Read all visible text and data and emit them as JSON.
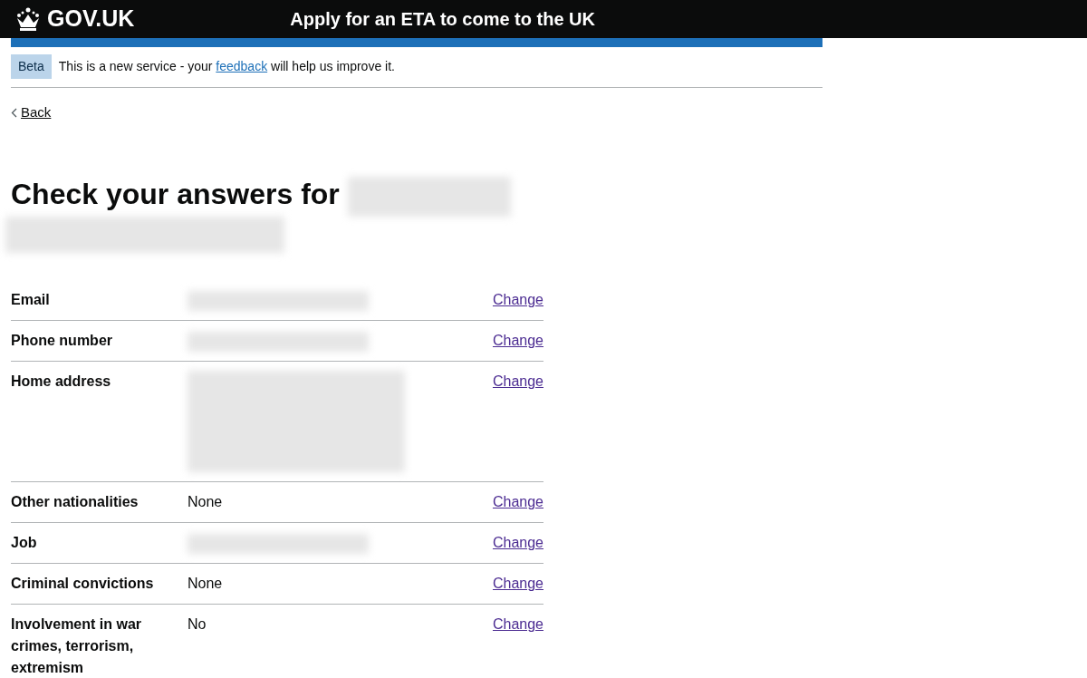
{
  "header": {
    "logo": "GOV.UK",
    "service_name": "Apply for an ETA to come to the UK"
  },
  "phase_banner": {
    "tag": "Beta",
    "text_before": "This is a new service - your",
    "link": "feedback",
    "text_after": "will help us improve it."
  },
  "back_link": "Back",
  "heading": {
    "text": "Check your answers for",
    "redacted": true
  },
  "summary": [
    {
      "key": "Email",
      "redacted": true,
      "action": "Change"
    },
    {
      "key": "Phone number",
      "redacted": true,
      "action": "Change"
    },
    {
      "key": "Home address",
      "redacted": true,
      "tall": true,
      "action": "Change"
    },
    {
      "key": "Other nationalities",
      "value": "None",
      "redacted": false,
      "action": "Change"
    },
    {
      "key": "Job",
      "redacted": true,
      "action": "Change"
    },
    {
      "key": "Criminal convictions",
      "value": "None",
      "redacted": false,
      "action": "Change"
    },
    {
      "key": "Involvement in war crimes, terrorism, extremism",
      "value": "No",
      "redacted": false,
      "action": "Change"
    }
  ]
}
